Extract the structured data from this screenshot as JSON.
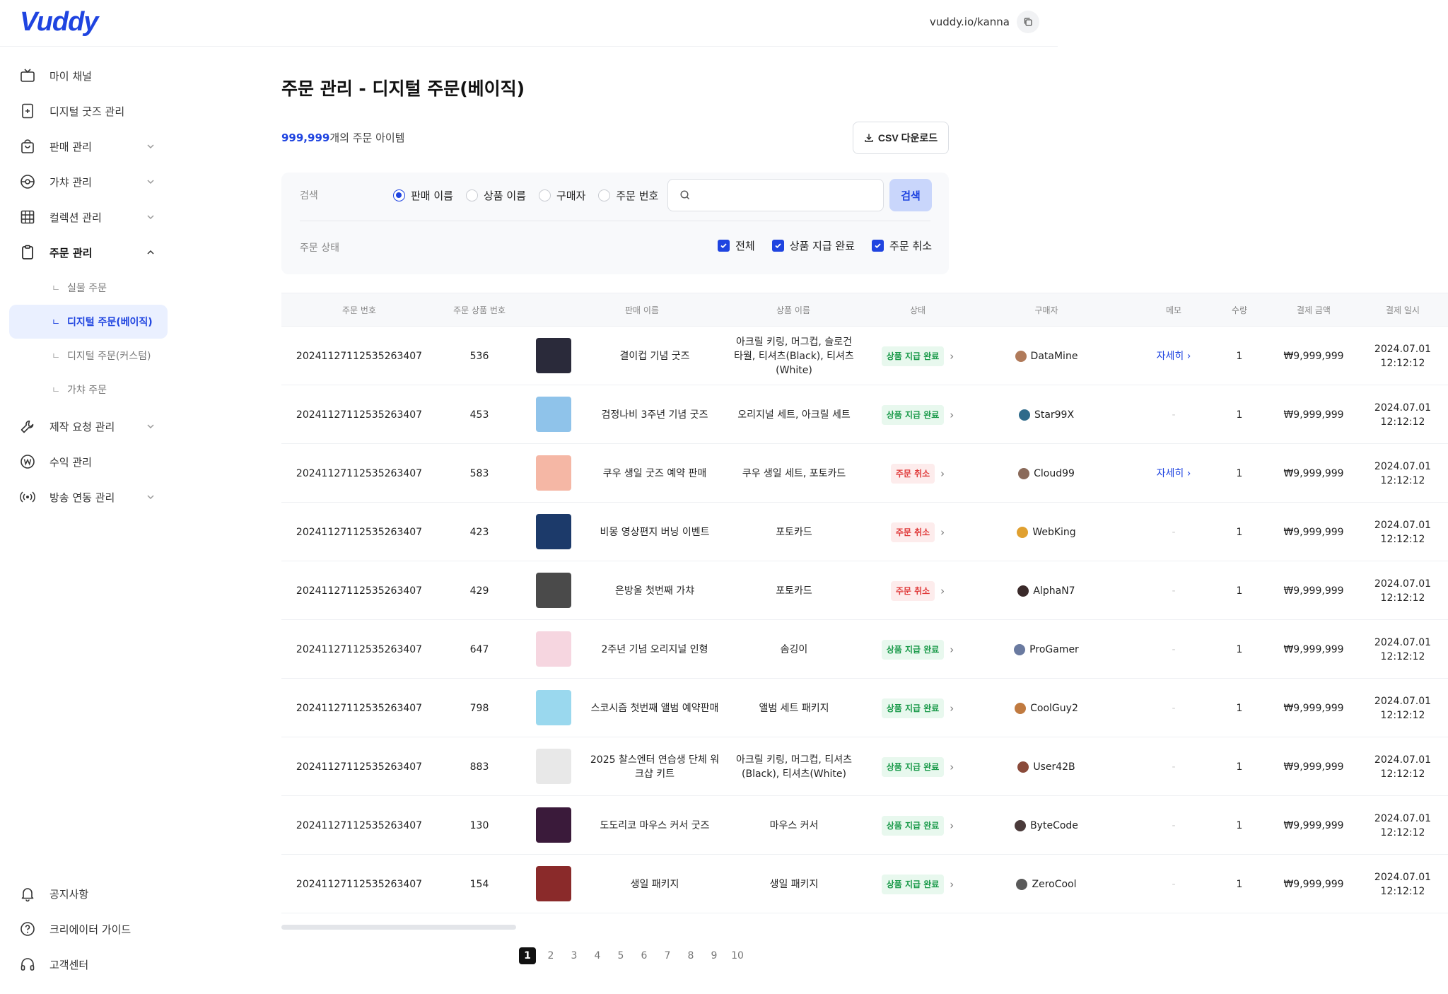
{
  "brand": {
    "logo": "Vuddy",
    "url": "vuddy.io/kanna"
  },
  "sidebar": {
    "items": [
      {
        "label": "마이 채널",
        "icon": "tv-icon"
      },
      {
        "label": "디지털 굿즈 관리",
        "icon": "device-plus-icon"
      },
      {
        "label": "판매 관리",
        "icon": "shopping-bag-icon"
      },
      {
        "label": "가챠 관리",
        "icon": "gacha-ball-icon"
      },
      {
        "label": "컬렉션 관리",
        "icon": "grid-icon"
      },
      {
        "label": "주문 관리",
        "icon": "clipboard-icon"
      },
      {
        "label": "제작 요청 관리",
        "icon": "wrench-icon"
      },
      {
        "label": "수익 관리",
        "icon": "won-coin-icon"
      },
      {
        "label": "방송 연동 관리",
        "icon": "broadcast-icon"
      }
    ],
    "sub_items": [
      {
        "label": "실물 주문"
      },
      {
        "label": "디지털 주문(베이직)"
      },
      {
        "label": "디지털 주문(커스텀)"
      },
      {
        "label": "가챠 주문"
      }
    ],
    "sub_mark": "ㄴ",
    "bottom": [
      {
        "label": "공지사항",
        "icon": "bell-icon"
      },
      {
        "label": "크리에이터 가이드",
        "icon": "question-circle-icon"
      },
      {
        "label": "고객센터",
        "icon": "headset-icon"
      }
    ]
  },
  "main": {
    "title": "주문 관리 - 디지털 주문(베이직)",
    "count_number": "999,999",
    "count_suffix": "개의 주문 아이템",
    "csv_label": "CSV 다운로드"
  },
  "filter": {
    "search_label": "검색",
    "radios": [
      "판매 이름",
      "상품 이름",
      "구매자",
      "주문 번호"
    ],
    "selected_radio": 0,
    "search_value": "",
    "search_button": "검색",
    "status_label": "주문 상태",
    "checks": [
      "전체",
      "상품 지급 완료",
      "주문 취소"
    ]
  },
  "table": {
    "headers": [
      "주문 번호",
      "주문 상품 번호",
      "판매 이름",
      "상품 이름",
      "상태",
      "구매자",
      "메모",
      "수량",
      "결제 금액",
      "결제 일시"
    ],
    "rows": [
      {
        "order_no": "20241127112535263407",
        "item_no": "536",
        "sale": "결이컵 기념 굿즈",
        "product": "아크릴 키링, 머그컵, 슬로건 타월, 티셔츠(Black), 티셔츠(White)",
        "status": "상품 지급 완료",
        "status_type": "ok",
        "buyer": "DataMine",
        "memo": "자세히",
        "qty": "1",
        "amount": "₩9,999,999",
        "date": "2024.07.01",
        "time": "12:12:12",
        "thumb": "#2a2a3a",
        "avatar": "#b07a5a"
      },
      {
        "order_no": "20241127112535263407",
        "item_no": "453",
        "sale": "검정나비 3주년 기념 굿즈",
        "product": "오리지널 세트, 아크릴 세트",
        "status": "상품 지급 완료",
        "status_type": "ok",
        "buyer": "Star99X",
        "memo": "-",
        "qty": "1",
        "amount": "₩9,999,999",
        "date": "2024.07.01",
        "time": "12:12:12",
        "thumb": "#8fc3ea",
        "avatar": "#2e6a8a"
      },
      {
        "order_no": "20241127112535263407",
        "item_no": "583",
        "sale": "쿠우 생일 굿즈 예약 판매",
        "product": "쿠우 생일 세트, 포토카드",
        "status": "주문 취소",
        "status_type": "cancel",
        "buyer": "Cloud99",
        "memo": "자세히",
        "qty": "1",
        "amount": "₩9,999,999",
        "date": "2024.07.01",
        "time": "12:12:12",
        "thumb": "#f5b7a5",
        "avatar": "#8a6a5a"
      },
      {
        "order_no": "20241127112535263407",
        "item_no": "423",
        "sale": "비몽 영상편지 버닝 이벤트",
        "product": "포토카드",
        "status": "주문 취소",
        "status_type": "cancel",
        "buyer": "WebKing",
        "memo": "-",
        "qty": "1",
        "amount": "₩9,999,999",
        "date": "2024.07.01",
        "time": "12:12:12",
        "thumb": "#1c3a6a",
        "avatar": "#e0a030"
      },
      {
        "order_no": "20241127112535263407",
        "item_no": "429",
        "sale": "은방울 첫번째 가챠",
        "product": "포토카드",
        "status": "주문 취소",
        "status_type": "cancel",
        "buyer": "AlphaN7",
        "memo": "-",
        "qty": "1",
        "amount": "₩9,999,999",
        "date": "2024.07.01",
        "time": "12:12:12",
        "thumb": "#4a4a4a",
        "avatar": "#3a2a2a"
      },
      {
        "order_no": "20241127112535263407",
        "item_no": "647",
        "sale": "2주년 기념 오리지널 인형",
        "product": "솜깅이",
        "status": "상품 지급 완료",
        "status_type": "ok",
        "buyer": "ProGamer",
        "memo": "-",
        "qty": "1",
        "amount": "₩9,999,999",
        "date": "2024.07.01",
        "time": "12:12:12",
        "thumb": "#f6d6e0",
        "avatar": "#6a7aa0"
      },
      {
        "order_no": "20241127112535263407",
        "item_no": "798",
        "sale": "스코시즘 첫번째 앨범 예약판매",
        "product": "앨범 세트 패키지",
        "status": "상품 지급 완료",
        "status_type": "ok",
        "buyer": "CoolGuy2",
        "memo": "-",
        "qty": "1",
        "amount": "₩9,999,999",
        "date": "2024.07.01",
        "time": "12:12:12",
        "thumb": "#9ad8ee",
        "avatar": "#c07a40"
      },
      {
        "order_no": "20241127112535263407",
        "item_no": "883",
        "sale": "2025 찰스엔터 연습생 단체 워크샵 키트",
        "product": "아크릴 키링, 머그컵, 티셔츠(Black), 티셔츠(White)",
        "status": "상품 지급 완료",
        "status_type": "ok",
        "buyer": "User42B",
        "memo": "-",
        "qty": "1",
        "amount": "₩9,999,999",
        "date": "2024.07.01",
        "time": "12:12:12",
        "thumb": "#e8e8e8",
        "avatar": "#8a4a3a"
      },
      {
        "order_no": "20241127112535263407",
        "item_no": "130",
        "sale": "도도리코 마우스 커서 굿즈",
        "product": "마우스 커서",
        "status": "상품 지급 완료",
        "status_type": "ok",
        "buyer": "ByteCode",
        "memo": "-",
        "qty": "1",
        "amount": "₩9,999,999",
        "date": "2024.07.01",
        "time": "12:12:12",
        "thumb": "#3a1a3a",
        "avatar": "#4a3a3a"
      },
      {
        "order_no": "20241127112535263407",
        "item_no": "154",
        "sale": "생일 패키지",
        "product": "생일 패키지",
        "status": "상품 지급 완료",
        "status_type": "ok",
        "buyer": "ZeroCool",
        "memo": "-",
        "qty": "1",
        "amount": "₩9,999,999",
        "date": "2024.07.01",
        "time": "12:12:12",
        "thumb": "#8a2a2a",
        "avatar": "#5a5a5a"
      }
    ]
  },
  "pagination": {
    "pages": [
      "1",
      "2",
      "3",
      "4",
      "5",
      "6",
      "7",
      "8",
      "9",
      "10"
    ],
    "current": "1"
  },
  "colors": {
    "accent": "#1f44e0",
    "ok": "#1a9a4a",
    "cancel": "#e03a3a"
  }
}
